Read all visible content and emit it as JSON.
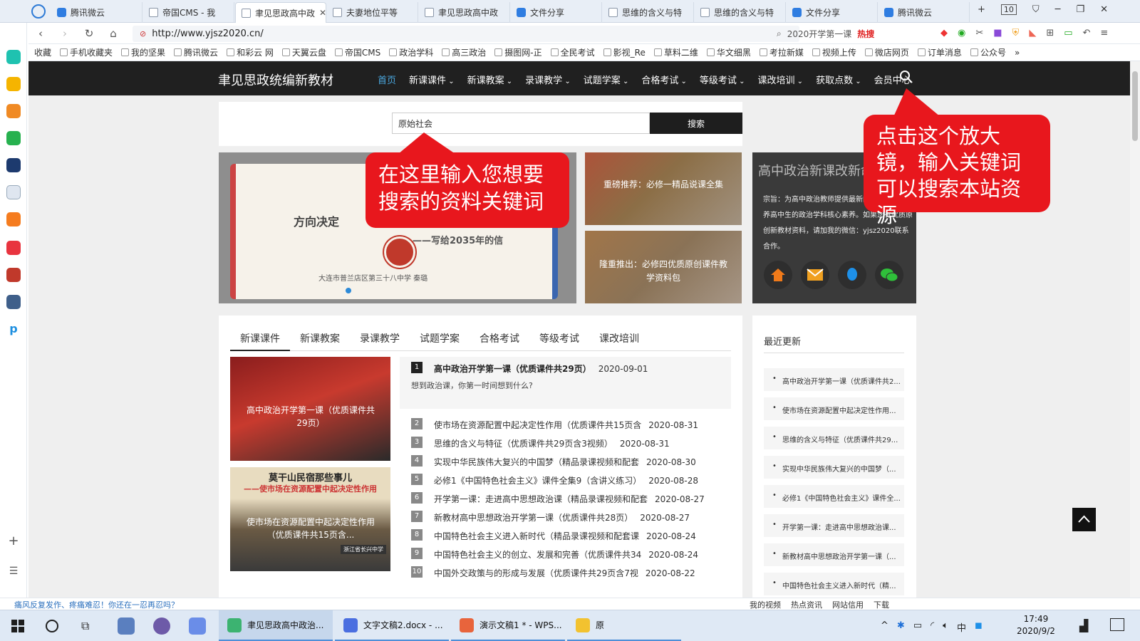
{
  "browser": {
    "tabs": [
      {
        "label": "腾讯微云",
        "icon": "cloud-icon"
      },
      {
        "label": "帝国CMS - 我",
        "icon": "page-icon"
      },
      {
        "label": "聿见思政高中政",
        "icon": "page-icon",
        "active": true
      },
      {
        "label": "夫妻地位平等",
        "icon": "page-icon"
      },
      {
        "label": "聿见思政高中政",
        "icon": "page-icon"
      },
      {
        "label": "文件分享",
        "icon": "cloud-icon"
      },
      {
        "label": "思维的含义与特",
        "icon": "page-icon"
      },
      {
        "label": "思维的含义与特",
        "icon": "page-icon"
      },
      {
        "label": "文件分享",
        "icon": "cloud-icon"
      },
      {
        "label": "腾讯微云",
        "icon": "cloud-icon"
      }
    ],
    "tab_count": "10",
    "url": "http://www.yjsz2020.cn/",
    "search_text": "2020开学第一课",
    "hot_label": "热搜",
    "bookmarks": [
      "收藏",
      "手机收藏夹",
      "我的坚果",
      "腾讯微云",
      "和彩云 网",
      "天翼云盘",
      "帝国CMS",
      "政治学科",
      "高三政治",
      "摄图网-正",
      "全民考试",
      "影视_Re",
      "草料二维",
      "华文细黑",
      "考拉新媒",
      "视频上传",
      "微店网页",
      "订单消息",
      "公众号",
      "»"
    ]
  },
  "site": {
    "logo": "聿见思政统编新教材",
    "nav": [
      "首页",
      "新课课件",
      "新课教案",
      "录课教学",
      "试题学案",
      "合格考试",
      "等级考试",
      "课改培训",
      "获取点数",
      "会员中心"
    ],
    "search_value": "原始社会",
    "search_button": "搜索",
    "banner": {
      "title": "方向决定",
      "subtitle": "——写给2035年的信",
      "school": "大连市普兰店区第三十八中学  秦璐"
    },
    "features": [
      {
        "caption": "重磅推荐：必修一精品说课全集"
      },
      {
        "caption": "隆重推出：必修四优质原创课件教学资料包"
      }
    ],
    "info": {
      "title": "高中政治新课改新命",
      "text": "宗旨：为高中政治教师提供最新的课改资源，培养高中生的政治学科核心素养。如果您有优质原创新教材资料，请加我的微信：yjsz2020联系合作。"
    },
    "callouts": {
      "search_hint": "在这里输入您想要搜索的资料关键词",
      "magnifier_hint": "点击这个放大镜，输入关键词可以搜索本站资源"
    },
    "content_tabs": [
      "新课课件",
      "新课教案",
      "录课教学",
      "试题学案",
      "合格考试",
      "等级考试",
      "课改培训"
    ],
    "thumbs": [
      {
        "caption": "高中政治开学第一课（优质课件共29页）"
      },
      {
        "caption": "使市场在资源配置中起决定性作用（优质课件共15页含...",
        "overlay_title": "莫干山民宿那些事儿",
        "overlay_subtitle": "——使市场在资源配置中起决定性作用",
        "overlay_credit": "浙江省长兴中学"
      }
    ],
    "first_item": {
      "num": "1",
      "title": "高中政治开学第一课（优质课件共29页）",
      "date": "2020-09-01",
      "desc": "想到政治课，你第一时间想到什么?"
    },
    "list": [
      {
        "num": "2",
        "title": "使市场在资源配置中起决定性作用（优质课件共15页含",
        "date": "2020-08-31"
      },
      {
        "num": "3",
        "title": "思维的含义与特征（优质课件共29页含3视频）",
        "date": "2020-08-31"
      },
      {
        "num": "4",
        "title": "实现中华民族伟大复兴的中国梦（精品录课视频和配套",
        "date": "2020-08-30"
      },
      {
        "num": "5",
        "title": "必修1《中国特色社会主义》课件全集9（含讲义练习）",
        "date": "2020-08-28"
      },
      {
        "num": "6",
        "title": "开学第一课：走进高中思想政治课（精品录课视频和配套",
        "date": "2020-08-27"
      },
      {
        "num": "7",
        "title": "新教材高中思想政治开学第一课（优质课件共28页）",
        "date": "2020-08-27"
      },
      {
        "num": "8",
        "title": "中国特色社会主义进入新时代（精品录课视频和配套课",
        "date": "2020-08-24"
      },
      {
        "num": "9",
        "title": "中国特色社会主义的创立、发展和完善（优质课件共34",
        "date": "2020-08-24"
      },
      {
        "num": "10",
        "title": "中国外交政策与的形成与发展（优质课件共29页含7视",
        "date": "2020-08-22"
      }
    ],
    "recent_title": "最近更新",
    "recent": [
      "高中政治开学第一课（优质课件共2...",
      "使市场在资源配置中起决定性作用...",
      "思维的含义与特征（优质课件共29...",
      "实现中华民族伟大复兴的中国梦（...",
      "必修1《中国特色社会主义》课件全...",
      "开学第一课：走进高中思想政治课...",
      "新教材高中思想政治开学第一课（...",
      "中国特色社会主义进入新时代（精..."
    ]
  },
  "statusbar": {
    "left": "痛风反复发作、疼痛难忍！你还在一忍再忍吗？",
    "right": [
      "我的视频",
      "热点资讯",
      "网站信用",
      "下载"
    ]
  },
  "taskbar": {
    "apps": [
      {
        "label": "聿见思政高中政治...",
        "color": "#3cb371",
        "active": true
      },
      {
        "label": "文字文稿2.docx - ...",
        "color": "#4a6ee0"
      },
      {
        "label": "演示文稿1 * - WPS...",
        "color": "#e8643c"
      },
      {
        "label": "原",
        "color": "#f2c230"
      }
    ],
    "time": "17:49",
    "date": "2020/9/2"
  },
  "colors": {
    "accent": "#e8171d",
    "nav_active": "#4aa8e0",
    "header_bg": "#202020"
  }
}
